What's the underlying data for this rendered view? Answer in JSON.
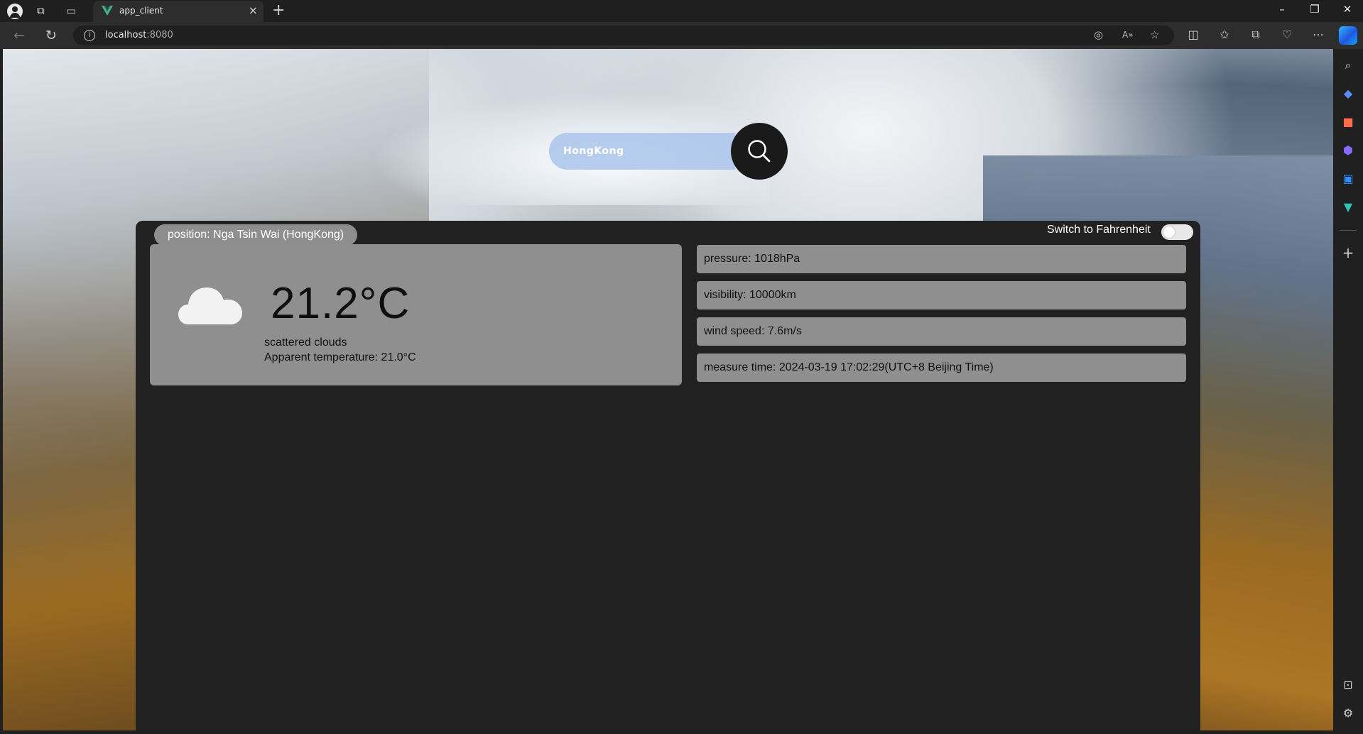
{
  "browser": {
    "tab_title": "app_client",
    "tab_close": "×",
    "new_tab": "+",
    "url_host": "localhost",
    "url_port": ":8080",
    "controls": {
      "minimize": "–",
      "restore": "❐",
      "close": "✕"
    }
  },
  "search": {
    "value": "HongKong"
  },
  "weather": {
    "position": "position: Nga Tsin Wai (HongKong)",
    "toggle_label": "Switch to Fahrenheit",
    "temperature": "21.2°C",
    "description": "scattered clouds",
    "apparent": "Apparent temperature: 21.0°C",
    "details": {
      "pressure": "pressure: 1018hPa",
      "visibility": "visibility: 10000km",
      "wind_speed": "wind speed: 7.6m/s",
      "measure_time": "measure time: 2024-03-19 17:02:29(UTC+8 Beijing Time)"
    }
  },
  "icons": {
    "weather_icon": "cloud-icon",
    "search_icon": "magnifier-icon"
  }
}
